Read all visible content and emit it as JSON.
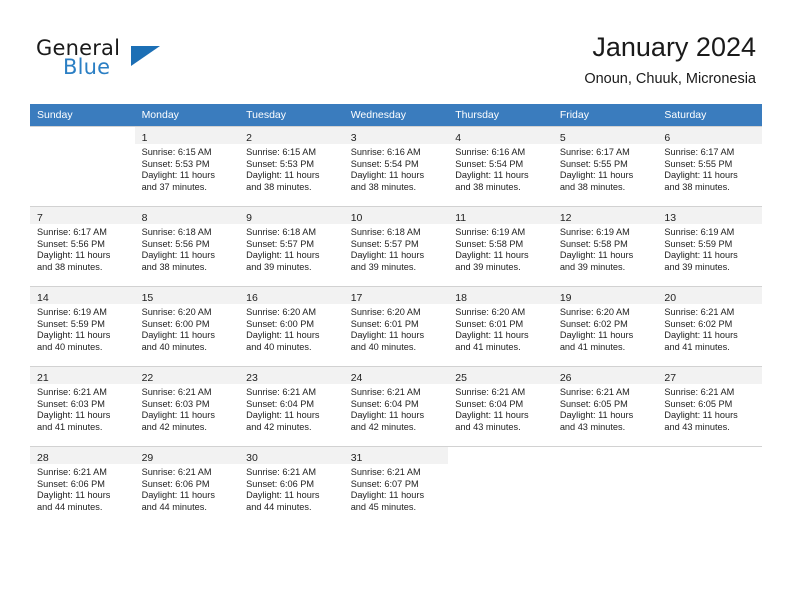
{
  "brand": {
    "name_part1": "General",
    "name_part2": "Blue",
    "triangle_icon": "triangle-icon",
    "accent_color": "#1c6fb5",
    "blue_text_color": "#2b7fc4"
  },
  "header": {
    "title": "January 2024",
    "subtitle": "Onoun, Chuuk, Micronesia"
  },
  "calendar": {
    "header_bg": "#3a7cbe",
    "header_text_color": "#ffffff",
    "daynum_bg": "#f2f2f2",
    "weekday_headers": [
      "Sunday",
      "Monday",
      "Tuesday",
      "Wednesday",
      "Thursday",
      "Friday",
      "Saturday"
    ],
    "weeks": [
      [
        {
          "day": "",
          "lines": []
        },
        {
          "day": "1",
          "lines": [
            "Sunrise: 6:15 AM",
            "Sunset: 5:53 PM",
            "Daylight: 11 hours",
            "and 37 minutes."
          ]
        },
        {
          "day": "2",
          "lines": [
            "Sunrise: 6:15 AM",
            "Sunset: 5:53 PM",
            "Daylight: 11 hours",
            "and 38 minutes."
          ]
        },
        {
          "day": "3",
          "lines": [
            "Sunrise: 6:16 AM",
            "Sunset: 5:54 PM",
            "Daylight: 11 hours",
            "and 38 minutes."
          ]
        },
        {
          "day": "4",
          "lines": [
            "Sunrise: 6:16 AM",
            "Sunset: 5:54 PM",
            "Daylight: 11 hours",
            "and 38 minutes."
          ]
        },
        {
          "day": "5",
          "lines": [
            "Sunrise: 6:17 AM",
            "Sunset: 5:55 PM",
            "Daylight: 11 hours",
            "and 38 minutes."
          ]
        },
        {
          "day": "6",
          "lines": [
            "Sunrise: 6:17 AM",
            "Sunset: 5:55 PM",
            "Daylight: 11 hours",
            "and 38 minutes."
          ]
        }
      ],
      [
        {
          "day": "7",
          "lines": [
            "Sunrise: 6:17 AM",
            "Sunset: 5:56 PM",
            "Daylight: 11 hours",
            "and 38 minutes."
          ]
        },
        {
          "day": "8",
          "lines": [
            "Sunrise: 6:18 AM",
            "Sunset: 5:56 PM",
            "Daylight: 11 hours",
            "and 38 minutes."
          ]
        },
        {
          "day": "9",
          "lines": [
            "Sunrise: 6:18 AM",
            "Sunset: 5:57 PM",
            "Daylight: 11 hours",
            "and 39 minutes."
          ]
        },
        {
          "day": "10",
          "lines": [
            "Sunrise: 6:18 AM",
            "Sunset: 5:57 PM",
            "Daylight: 11 hours",
            "and 39 minutes."
          ]
        },
        {
          "day": "11",
          "lines": [
            "Sunrise: 6:19 AM",
            "Sunset: 5:58 PM",
            "Daylight: 11 hours",
            "and 39 minutes."
          ]
        },
        {
          "day": "12",
          "lines": [
            "Sunrise: 6:19 AM",
            "Sunset: 5:58 PM",
            "Daylight: 11 hours",
            "and 39 minutes."
          ]
        },
        {
          "day": "13",
          "lines": [
            "Sunrise: 6:19 AM",
            "Sunset: 5:59 PM",
            "Daylight: 11 hours",
            "and 39 minutes."
          ]
        }
      ],
      [
        {
          "day": "14",
          "lines": [
            "Sunrise: 6:19 AM",
            "Sunset: 5:59 PM",
            "Daylight: 11 hours",
            "and 40 minutes."
          ]
        },
        {
          "day": "15",
          "lines": [
            "Sunrise: 6:20 AM",
            "Sunset: 6:00 PM",
            "Daylight: 11 hours",
            "and 40 minutes."
          ]
        },
        {
          "day": "16",
          "lines": [
            "Sunrise: 6:20 AM",
            "Sunset: 6:00 PM",
            "Daylight: 11 hours",
            "and 40 minutes."
          ]
        },
        {
          "day": "17",
          "lines": [
            "Sunrise: 6:20 AM",
            "Sunset: 6:01 PM",
            "Daylight: 11 hours",
            "and 40 minutes."
          ]
        },
        {
          "day": "18",
          "lines": [
            "Sunrise: 6:20 AM",
            "Sunset: 6:01 PM",
            "Daylight: 11 hours",
            "and 41 minutes."
          ]
        },
        {
          "day": "19",
          "lines": [
            "Sunrise: 6:20 AM",
            "Sunset: 6:02 PM",
            "Daylight: 11 hours",
            "and 41 minutes."
          ]
        },
        {
          "day": "20",
          "lines": [
            "Sunrise: 6:21 AM",
            "Sunset: 6:02 PM",
            "Daylight: 11 hours",
            "and 41 minutes."
          ]
        }
      ],
      [
        {
          "day": "21",
          "lines": [
            "Sunrise: 6:21 AM",
            "Sunset: 6:03 PM",
            "Daylight: 11 hours",
            "and 41 minutes."
          ]
        },
        {
          "day": "22",
          "lines": [
            "Sunrise: 6:21 AM",
            "Sunset: 6:03 PM",
            "Daylight: 11 hours",
            "and 42 minutes."
          ]
        },
        {
          "day": "23",
          "lines": [
            "Sunrise: 6:21 AM",
            "Sunset: 6:04 PM",
            "Daylight: 11 hours",
            "and 42 minutes."
          ]
        },
        {
          "day": "24",
          "lines": [
            "Sunrise: 6:21 AM",
            "Sunset: 6:04 PM",
            "Daylight: 11 hours",
            "and 42 minutes."
          ]
        },
        {
          "day": "25",
          "lines": [
            "Sunrise: 6:21 AM",
            "Sunset: 6:04 PM",
            "Daylight: 11 hours",
            "and 43 minutes."
          ]
        },
        {
          "day": "26",
          "lines": [
            "Sunrise: 6:21 AM",
            "Sunset: 6:05 PM",
            "Daylight: 11 hours",
            "and 43 minutes."
          ]
        },
        {
          "day": "27",
          "lines": [
            "Sunrise: 6:21 AM",
            "Sunset: 6:05 PM",
            "Daylight: 11 hours",
            "and 43 minutes."
          ]
        }
      ],
      [
        {
          "day": "28",
          "lines": [
            "Sunrise: 6:21 AM",
            "Sunset: 6:06 PM",
            "Daylight: 11 hours",
            "and 44 minutes."
          ]
        },
        {
          "day": "29",
          "lines": [
            "Sunrise: 6:21 AM",
            "Sunset: 6:06 PM",
            "Daylight: 11 hours",
            "and 44 minutes."
          ]
        },
        {
          "day": "30",
          "lines": [
            "Sunrise: 6:21 AM",
            "Sunset: 6:06 PM",
            "Daylight: 11 hours",
            "and 44 minutes."
          ]
        },
        {
          "day": "31",
          "lines": [
            "Sunrise: 6:21 AM",
            "Sunset: 6:07 PM",
            "Daylight: 11 hours",
            "and 45 minutes."
          ]
        },
        {
          "day": "",
          "lines": []
        },
        {
          "day": "",
          "lines": []
        },
        {
          "day": "",
          "lines": []
        }
      ]
    ]
  }
}
